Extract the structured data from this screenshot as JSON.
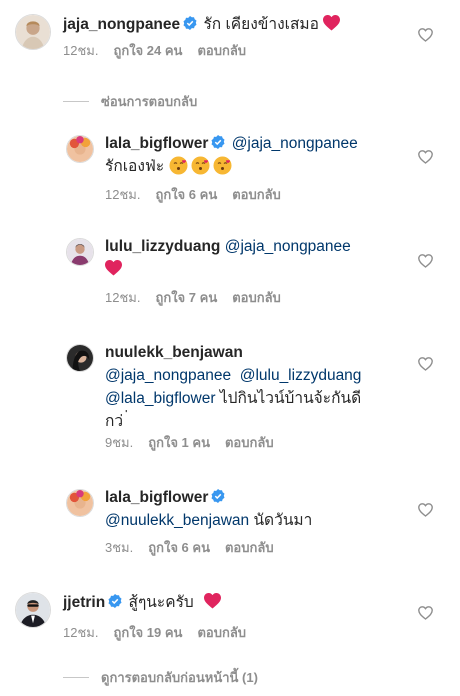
{
  "comments": [
    {
      "username": "jaja_nongpanee",
      "verified": true,
      "text": "รัก เคียงข้างเสมอ",
      "time": "12ชม.",
      "likes": "ถูกใจ 24 คน",
      "reply": "ตอบกลับ"
    }
  ],
  "toggles": {
    "hide_replies": "ซ่อนการตอบกลับ",
    "view_previous": "ดูการตอบกลับก่อนหน้านี้ (1)"
  },
  "replies": [
    {
      "username": "lala_bigflower",
      "verified": true,
      "mention": "@jaja_nongpanee",
      "text": "รักเองฟ่ะ",
      "time": "12ชม.",
      "likes": "ถูกใจ 6 คน",
      "reply": "ตอบกลับ"
    },
    {
      "username": "lulu_lizzyduang",
      "verified": false,
      "mention": "@jaja_nongpanee",
      "text": "",
      "time": "12ชม.",
      "likes": "ถูกใจ 7 คน",
      "reply": "ตอบกลับ"
    },
    {
      "username": "nuulekk_benjawan",
      "verified": false,
      "mentions": [
        "@jaja_nongpanee",
        "@lulu_lizzyduang",
        "@lala_bigflower"
      ],
      "text": "ไปกินไวน์บ้านจ้ะกันดี",
      "text2": "กว่ ่",
      "time": "9ชม.",
      "likes": "ถูกใจ 1 คน",
      "reply": "ตอบกลับ"
    },
    {
      "username": "lala_bigflower",
      "verified": true,
      "mention": "@nuulekk_benjawan",
      "text": "นัดวันมา",
      "time": "3ชม.",
      "likes": "ถูกใจ 6 คน",
      "reply": "ตอบกลับ"
    }
  ],
  "comment2": {
    "username": "jjetrin",
    "verified": true,
    "text": "สู้ๆนะครับ",
    "time": "12ชม.",
    "likes": "ถูกใจ 19 คน",
    "reply": "ตอบกลับ"
  },
  "colors": {
    "verified_blue": "#3897f0",
    "mention_blue": "#00376b",
    "meta_gray": "#8e8e8e",
    "heart_red": "#e0245e"
  },
  "icons": [
    "verified-badge-icon",
    "heart-outline-icon",
    "red-heart-emoji",
    "kissing-face-emoji"
  ]
}
